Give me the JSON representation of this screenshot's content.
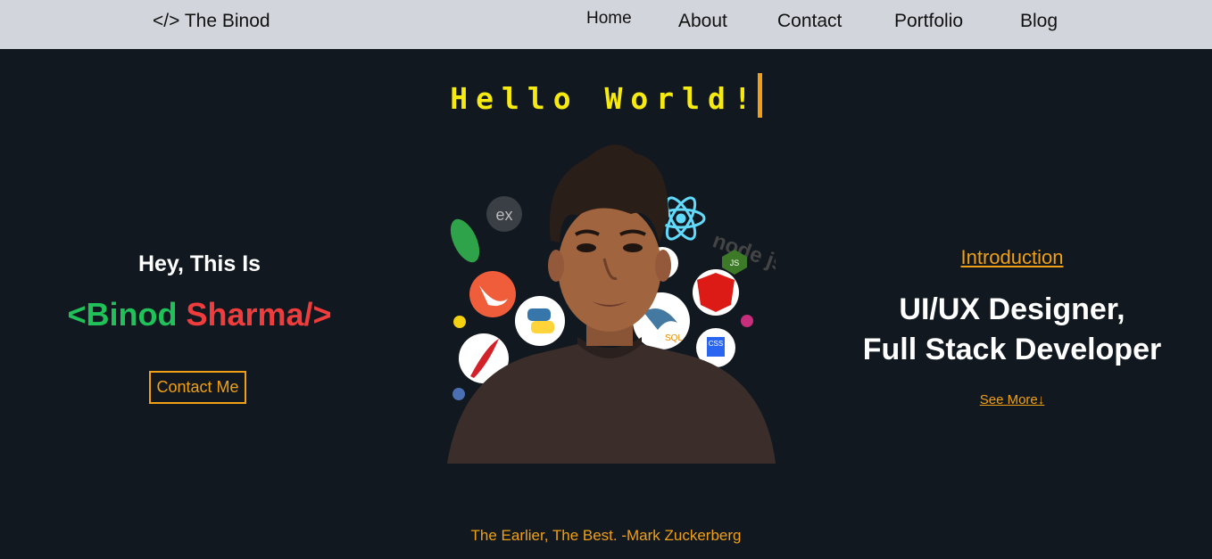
{
  "nav": {
    "brand": "</> The Binod",
    "links": [
      "Home",
      "About",
      "Contact",
      "Portfolio",
      "Blog"
    ]
  },
  "hero": {
    "typing_text": "Hello World!",
    "greeting": "Hey, This Is",
    "name_first": "<Binod",
    "name_last": "Sharma/>",
    "contact_button": "Contact Me",
    "intro_link": "Introduction",
    "role_line1": "UI/UX Designer,",
    "role_line2": "Full Stack Developer",
    "see_more": "See More↓",
    "quote": "The Earlier, The Best. -Mark Zuckerberg"
  },
  "portrait": {
    "tech_badges": [
      "ex",
      "node js",
      "JS",
      "SQL",
      "CSS"
    ]
  },
  "colors": {
    "nav_bg": "#d3d5dc",
    "page_bg": "#111820",
    "accent": "#f0a014",
    "typing": "#f6ea10",
    "name_green": "#21c15a",
    "name_red": "#ef3d3d"
  }
}
